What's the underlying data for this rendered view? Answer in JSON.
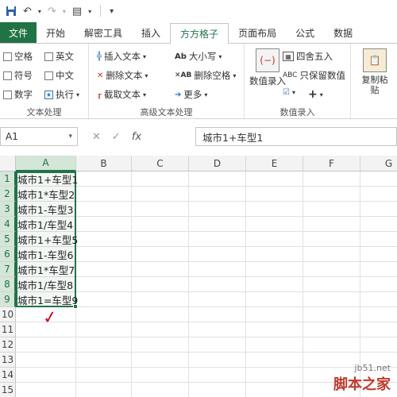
{
  "qat": {
    "items": [
      {
        "name": "save-icon",
        "glyph": "💾"
      },
      {
        "name": "undo-icon",
        "glyph": "↶"
      },
      {
        "name": "redo-icon",
        "glyph": "↷"
      },
      {
        "name": "form-icon",
        "glyph": "▤"
      },
      {
        "name": "customize-qat-icon",
        "glyph": "⫶"
      }
    ]
  },
  "tabs": [
    "文件",
    "开始",
    "解密工具",
    "插入",
    "方方格子",
    "页面布局",
    "公式",
    "数据"
  ],
  "active_tab": "方方格子",
  "ribbon": {
    "text_group": {
      "items": [
        "空格",
        "英文",
        "符号",
        "中文",
        "数字",
        "执行"
      ],
      "label": "文本处理"
    },
    "advanced_group": {
      "col1": [
        "插入文本",
        "删除文本",
        "截取文本"
      ],
      "col2": [
        "大小写",
        "删除空格",
        "更多"
      ],
      "label": "高级文本处理"
    },
    "entry_group": {
      "big_btn": "数值录入",
      "items": [
        "四舍五入",
        "只保留数值"
      ],
      "label": "数值录入"
    },
    "paste_btn": "复制粘贴"
  },
  "formula_bar": {
    "name_box": "A1",
    "cancel": "✕",
    "enter": "✓",
    "fx": "fx",
    "formula": "城市1+车型1"
  },
  "grid": {
    "columns": [
      "A",
      "B",
      "C",
      "D",
      "E",
      "F",
      "G"
    ],
    "rows": [
      "1",
      "2",
      "3",
      "4",
      "5",
      "6",
      "7",
      "8",
      "9",
      "10",
      "11",
      "12",
      "13",
      "14",
      "15"
    ],
    "cells_A": [
      "城市1+车型1",
      "城市1*车型2",
      "城市1-车型3",
      "城市1/车型4",
      "城市1+车型5",
      "城市1-车型6",
      "城市1*车型7",
      "城市1/车型8",
      "城市1=车型9"
    ]
  },
  "annotation": "✓",
  "watermark": {
    "url": "jb51.net",
    "text": "脚本之家"
  },
  "colors": {
    "excel_green": "#217346",
    "accent_red": "#c0392b"
  }
}
